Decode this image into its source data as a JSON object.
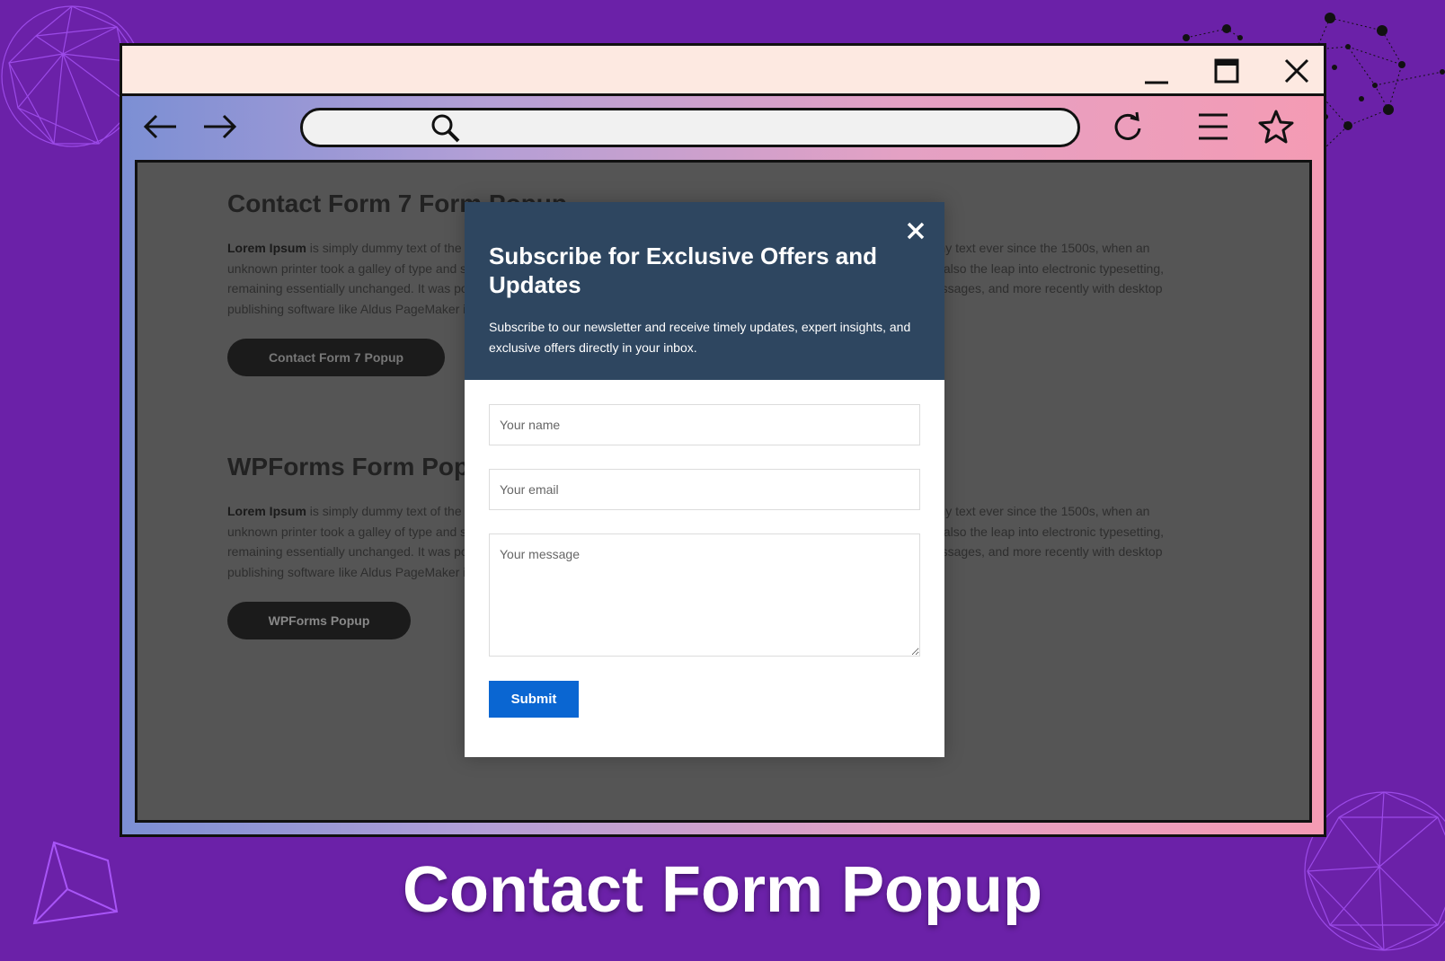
{
  "colors": {
    "background": "#6b21a8",
    "titlebar": "#fde9e1",
    "viewport_overlay": "#555555",
    "modal_header": "#2e4660",
    "submit_button": "#0a66d2"
  },
  "window": {
    "controls": {
      "minimize_icon": "minimize-icon",
      "maximize_icon": "maximize-icon",
      "close_icon": "close-icon"
    }
  },
  "toolbar": {
    "back_icon": "arrow-left-icon",
    "forward_icon": "arrow-right-icon",
    "search_icon": "search-icon",
    "address_value": "",
    "reload_icon": "reload-icon",
    "menu_icon": "hamburger-menu-icon",
    "bookmark_icon": "star-icon"
  },
  "page": {
    "sections": [
      {
        "heading": "Contact Form 7 Form Popup",
        "lead": "Lorem Ipsum",
        "body": " is simply dummy text of the printing and typesetting industry. Lorem Ipsum has been the industry's standard dummy text ever since the 1500s, when an unknown printer took a galley of type and scrambled it to make a type specimen book. It has survived not only five centuries, but also the leap into electronic typesetting, remaining essentially unchanged. It was popularised in the 1960s with the release of Letraset sheets containing Lorem Ipsum passages, and more recently with desktop publishing software like Aldus PageMaker including versions of Lorem Ipsum.",
        "button": "Contact Form 7 Popup"
      },
      {
        "heading": "WPForms Form Popup",
        "lead": "Lorem Ipsum",
        "body": " is simply dummy text of the printing and typesetting industry. Lorem Ipsum has been the industry's standard dummy text ever since the 1500s, when an unknown printer took a galley of type and scrambled it to make a type specimen book. It has survived not only five centuries, but also the leap into electronic typesetting, remaining essentially unchanged. It was popularised in the 1960s with the release of Letraset sheets containing Lorem Ipsum passages, and more recently with desktop publishing software like Aldus PageMaker including versions of Lorem Ipsum.",
        "button": "WPForms Popup"
      }
    ]
  },
  "modal": {
    "title": "Subscribe for Exclusive Offers and Updates",
    "description": "Subscribe to our newsletter and receive timely updates, expert insights, and exclusive offers directly in your inbox.",
    "close_icon": "close-icon",
    "fields": {
      "name_placeholder": "Your name",
      "email_placeholder": "Your email",
      "message_placeholder": "Your message"
    },
    "submit_label": "Submit"
  },
  "caption": "Contact Form Popup"
}
